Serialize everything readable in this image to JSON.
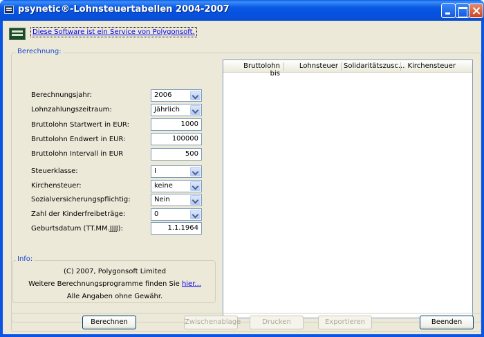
{
  "window": {
    "title": "psynetic®-Lohnsteuertabellen 2004-2007"
  },
  "service_link": "Diese Software ist ein Service von Polygonsoft.",
  "berechnung": {
    "legend": "Berechnung:",
    "fields": {
      "jahr": {
        "label": "Berechnungsjahr:",
        "value": "2006"
      },
      "zeitraum": {
        "label": "Lohnzahlungszeitraum:",
        "value": "Jährlich"
      },
      "start": {
        "label": "Bruttolohn Startwert in EUR:",
        "value": "1000"
      },
      "end": {
        "label": "Bruttolohn Endwert in EUR:",
        "value": "100000"
      },
      "intervall": {
        "label": "Bruttolohn Intervall in EUR",
        "value": "500"
      },
      "steuerklasse": {
        "label": "Steuerklasse:",
        "value": "I"
      },
      "kirchensteuer": {
        "label": "Kirchensteuer:",
        "value": "keine"
      },
      "sozial": {
        "label": "Sozialversicherungspflichtig:",
        "value": "Nein"
      },
      "kinder": {
        "label": "Zahl der Kinderfreibeträge:",
        "value": "0"
      },
      "geburt": {
        "label": "Geburtsdatum (TT.MM.JJJJ):",
        "value": "1.1.1964"
      }
    }
  },
  "table": {
    "columns": [
      "Bruttolohn bis",
      "Lohnsteuer",
      "Solidaritätszusc...",
      "Kirchensteuer"
    ]
  },
  "info": {
    "legend": "Info:",
    "copyright": "(C) 2007, Polygonsoft Limited",
    "more_prefix": "Weitere Berechnungsprogramme finden Sie",
    "more_link": "hier...",
    "disclaimer": "Alle Angaben ohne Gewähr."
  },
  "buttons": {
    "berechnen": "Berechnen",
    "zwischenablage": "Zwischenablage",
    "drucken": "Drucken",
    "exportieren": "Exportieren",
    "beenden": "Beenden"
  }
}
